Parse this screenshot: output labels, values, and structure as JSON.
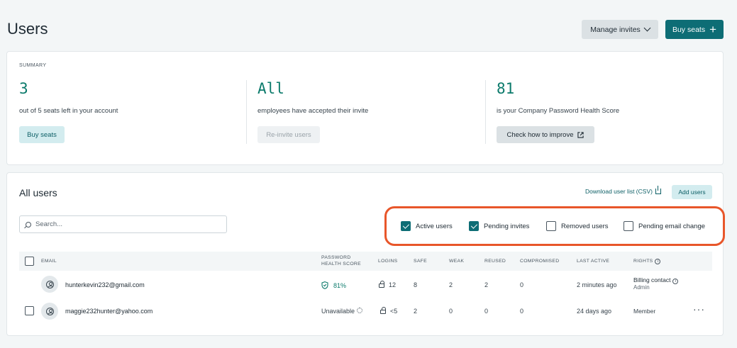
{
  "header": {
    "title": "Users",
    "manage_invites_label": "Manage invites",
    "buy_seats_label": "Buy seats"
  },
  "summary": {
    "label": "SUMMARY",
    "seats": {
      "value": "3",
      "description": "out of 5 seats left in your account",
      "button": "Buy seats"
    },
    "invites": {
      "value": "All",
      "description": "employees have accepted their invite",
      "button": "Re-invite users"
    },
    "score": {
      "value": "81",
      "description": "is your Company Password Health Score",
      "button": "Check how to improve"
    }
  },
  "users": {
    "title": "All users",
    "download_label": "Download user list (CSV)",
    "add_users_label": "Add users",
    "search_placeholder": "Search...",
    "filters": [
      {
        "label": "Active users",
        "checked": true
      },
      {
        "label": "Pending invites",
        "checked": true
      },
      {
        "label": "Removed users",
        "checked": false
      },
      {
        "label": "Pending email change",
        "checked": false
      }
    ],
    "columns": {
      "email": "EMAIL",
      "password_health_score_line1": "PASSWORD",
      "password_health_score_line2": "HEALTH SCORE",
      "logins": "LOGINS",
      "safe": "SAFE",
      "weak": "WEAK",
      "reused": "REUSED",
      "compromised": "COMPROMISED",
      "last_active": "LAST ACTIVE",
      "rights": "RIGHTS"
    },
    "rows": [
      {
        "email": "hunterkevin232@gmail.com",
        "score": "81%",
        "logins": "12",
        "safe": "8",
        "weak": "2",
        "reused": "2",
        "compromised": "0",
        "last_active": "2 minutes ago",
        "rights": "Billing contact",
        "rights_sub": "Admin"
      },
      {
        "email": "maggie232hunter@yahoo.com",
        "score": "Unavailable",
        "logins": "<5",
        "safe": "2",
        "weak": "0",
        "reused": "0",
        "compromised": "0",
        "last_active": "24 days ago",
        "rights": "Member",
        "more": "···"
      }
    ]
  },
  "colors": {
    "accent": "#0d6d75",
    "score_green": "#0b7a6b",
    "highlight": "#e8562a"
  }
}
